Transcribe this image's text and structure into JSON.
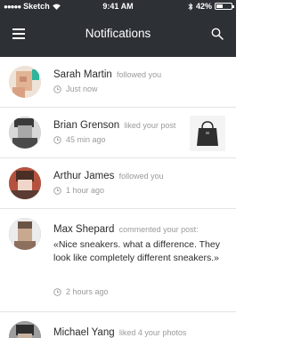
{
  "status_bar": {
    "carrier": "Sketch",
    "time": "9:41 AM",
    "battery": "42%",
    "battery_level": 0.42
  },
  "nav": {
    "title": "Notifications"
  },
  "notifications": [
    {
      "name": "Sarah Martin",
      "action": "followed you",
      "time": "Just now"
    },
    {
      "name": "Brian Grenson",
      "action": "liked your post",
      "time": "45 min ago"
    },
    {
      "name": "Arthur James",
      "action": "followed you",
      "time": "1 hour ago"
    },
    {
      "name": "Max Shepard",
      "action": "commented your post:",
      "comment": "«Nice sneakers. what a difference. They look like completely different sneakers.»",
      "time": "2 hours ago"
    },
    {
      "name": "Michael Yang",
      "action": "liked 4 your photos"
    }
  ]
}
